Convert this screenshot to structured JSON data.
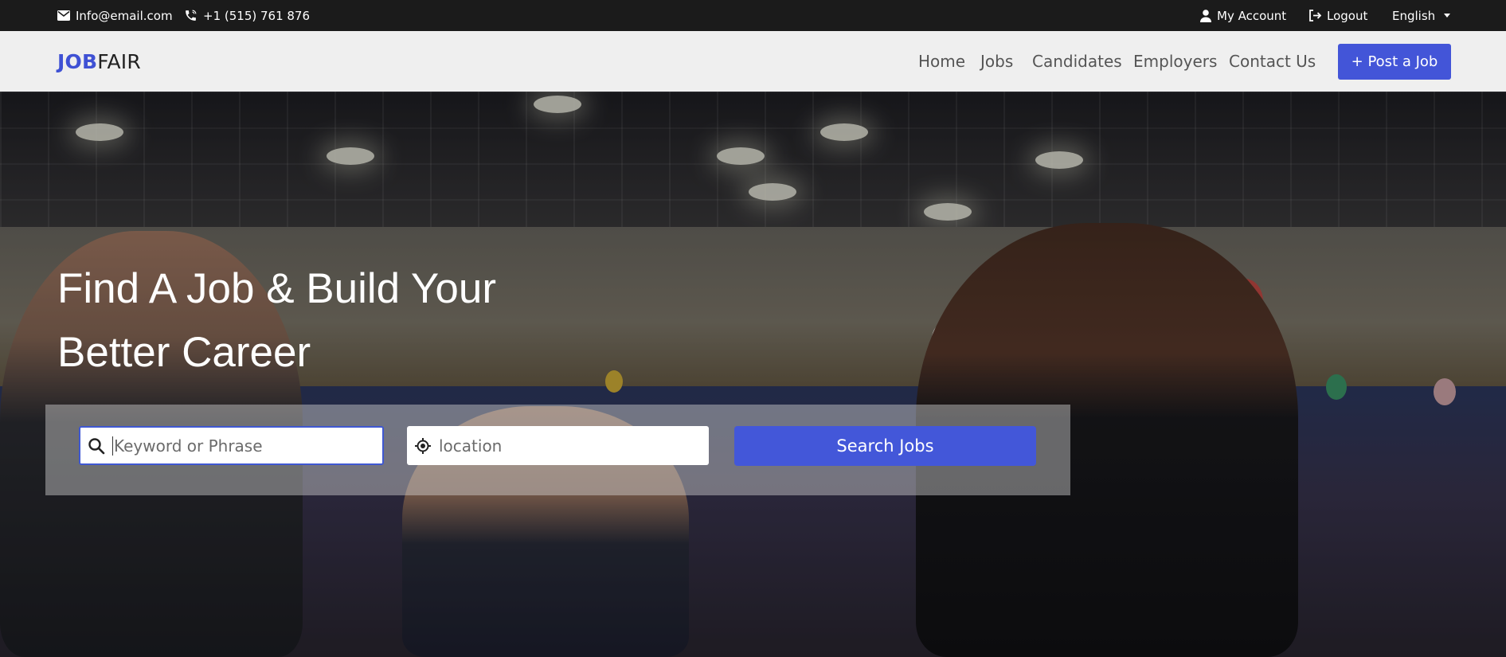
{
  "topbar": {
    "email": "Info@email.com",
    "phone": "+1 (515) 761 876",
    "account": "My Account",
    "logout": "Logout",
    "language": "English"
  },
  "brand": {
    "logo_bold": "JOB",
    "logo_regular": "FAIR"
  },
  "nav": {
    "items": [
      "Home",
      "Jobs",
      "Candidates",
      "Employers",
      "Contact Us"
    ],
    "post_job": "+ Post a Job"
  },
  "hero": {
    "title_line1": "Find A Job & Build Your",
    "title_line2": "Better Career",
    "search": {
      "keyword_placeholder": "Keyword or Phrase",
      "location_placeholder": "location",
      "button": "Search Jobs"
    }
  },
  "colors": {
    "accent": "#4355d8",
    "topbar_bg": "#1b1b1b",
    "navbar_bg": "#efefef"
  },
  "icons": [
    "envelope-icon",
    "phone-icon",
    "user-icon",
    "logout-icon",
    "search-icon",
    "location-crosshair-icon"
  ]
}
